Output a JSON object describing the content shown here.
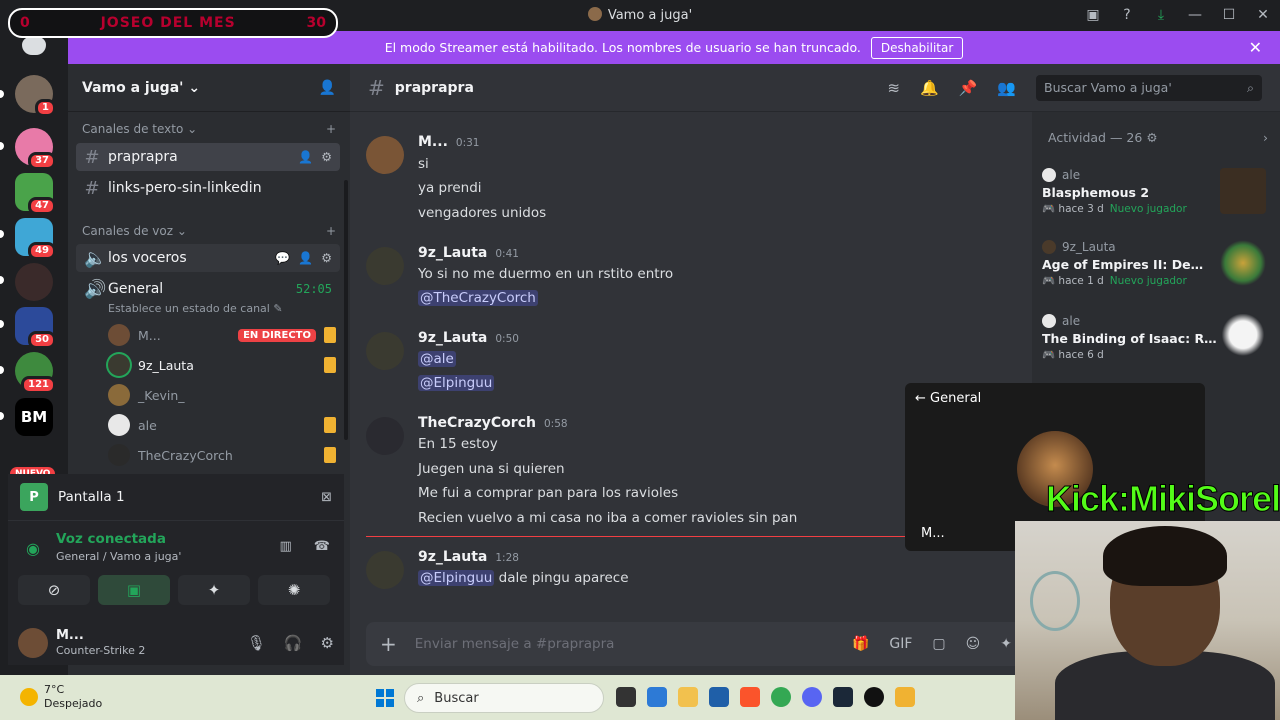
{
  "overlay": {
    "left_num": "0",
    "title": "JOSEO DEL MES",
    "right_num": "30"
  },
  "window": {
    "title": "Vamo a juga'"
  },
  "banner": {
    "text": "El modo Streamer está habilitado. Los nombres de usuario se han truncado.",
    "button": "Deshabilitar"
  },
  "rail": {
    "badges": [
      "1",
      "37",
      "47",
      "49",
      "50",
      "121"
    ],
    "nuevo": "NUEVO",
    "bm": "BM"
  },
  "server": {
    "name": "Vamo a juga'",
    "text_category": "Canales de texto",
    "voice_category": "Canales de voz",
    "text_channels": [
      "praprapra",
      "links-pero-sin-linkedin"
    ],
    "voice_channels": [
      {
        "name": "los voceros"
      },
      {
        "name": "General",
        "time": "52:05",
        "status": "Establece un estado de canal"
      }
    ],
    "voice_users": [
      {
        "name": "M...",
        "live": "EN DIRECTO"
      },
      {
        "name": "9z_Lauta"
      },
      {
        "name": "_Kevin_"
      },
      {
        "name": "ale"
      },
      {
        "name": "TheCrazyCorch"
      }
    ]
  },
  "stream_panel": {
    "title": "Pantalla 1",
    "icon": "P"
  },
  "voice_panel": {
    "status": "Voz conectada",
    "location": "General / Vamo a juga'"
  },
  "user_panel": {
    "name": "M...",
    "activity": "Counter-Strike 2"
  },
  "chat": {
    "channel": "praprapra",
    "search_placeholder": "Buscar Vamo a juga'",
    "messages": [
      {
        "author": "M...",
        "time": "0:31",
        "lines": [
          "si",
          "ya prendi",
          "vengadores unidos"
        ]
      },
      {
        "author": "9z_Lauta",
        "time": "0:41",
        "lines": [
          "Yo si no me duermo en un rstito entro",
          "@TheCrazyCorch"
        ]
      },
      {
        "author": "9z_Lauta",
        "time": "0:50",
        "lines": [
          "@ale",
          "@Elpinguu"
        ]
      },
      {
        "author": "TheCrazyCorch",
        "time": "0:58",
        "lines": [
          "En 15 estoy",
          "Juegen una si quieren",
          "Me fui a comprar pan para los ravioles",
          "Recien vuelvo a mi casa no iba a comer ravioles sin pan"
        ]
      },
      {
        "author": "9z_Lauta",
        "time": "1:28",
        "lines": [
          "@Elpinguu",
          "dale pingu aparece"
        ]
      }
    ],
    "composer_placeholder": "Enviar mensaje a #praprapra"
  },
  "activity": {
    "header": "Actividad — 26",
    "cards": [
      {
        "user": "ale",
        "game": "Blasphemous 2",
        "ago": "hace 3 d",
        "tag": "Nuevo jugador"
      },
      {
        "user": "9z_Lauta",
        "game": "Age of Empires II: Definitiv...",
        "ago": "hace 1 d",
        "tag": "Nuevo jugador"
      },
      {
        "user": "ale",
        "game": "The Binding of Isaac: Rebirth",
        "ago": "hace 6 d",
        "tag": ""
      }
    ]
  },
  "popout": {
    "back_label": "General",
    "name": "M..."
  },
  "overlay_text": "Kick:MikiSorel",
  "taskbar": {
    "temp": "7°C",
    "weather": "Despejado",
    "search": "Buscar"
  }
}
